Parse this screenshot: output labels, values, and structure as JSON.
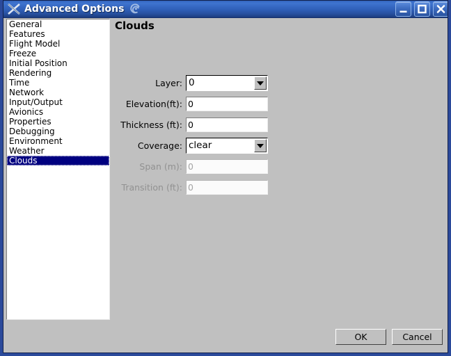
{
  "window": {
    "title": "Advanced Options",
    "app_icon": "flightgear-x-icon",
    "title_side_icon": "swirl-icon",
    "controls": [
      {
        "name": "minimize-button",
        "glyph": "minimize-icon"
      },
      {
        "name": "maximize-button",
        "glyph": "maximize-icon"
      },
      {
        "name": "close-button",
        "glyph": "close-icon"
      }
    ],
    "accent_titlebar": "#3f74cf",
    "frame_border": "#2b4a9b"
  },
  "sidebar": {
    "selected": "Clouds",
    "selected_bg": "#000080",
    "items": [
      {
        "label": "General"
      },
      {
        "label": "Features"
      },
      {
        "label": "Flight Model"
      },
      {
        "label": "Freeze"
      },
      {
        "label": "Initial Position"
      },
      {
        "label": "Rendering"
      },
      {
        "label": "Time"
      },
      {
        "label": "Network"
      },
      {
        "label": "Input/Output"
      },
      {
        "label": "Avionics"
      },
      {
        "label": "Properties"
      },
      {
        "label": "Debugging"
      },
      {
        "label": "Environment"
      },
      {
        "label": "Weather"
      },
      {
        "label": "Clouds"
      }
    ]
  },
  "panel": {
    "title": "Clouds",
    "fields": [
      {
        "label": "Layer:",
        "type": "combobox",
        "value": "0",
        "disabled": false,
        "name": "layer"
      },
      {
        "label": "Elevation(ft):",
        "type": "text",
        "value": "0",
        "disabled": false,
        "name": "elevation"
      },
      {
        "label": "Thickness (ft):",
        "type": "text",
        "value": "0",
        "disabled": false,
        "name": "thickness"
      },
      {
        "label": "Coverage:",
        "type": "combobox",
        "value": "clear",
        "disabled": false,
        "name": "coverage"
      },
      {
        "label": "Span (m):",
        "type": "text",
        "value": "0",
        "disabled": true,
        "name": "span"
      },
      {
        "label": "Transition (ft):",
        "type": "text",
        "value": "0",
        "disabled": true,
        "name": "transition"
      }
    ]
  },
  "buttons": {
    "ok": "OK",
    "cancel": "Cancel"
  }
}
